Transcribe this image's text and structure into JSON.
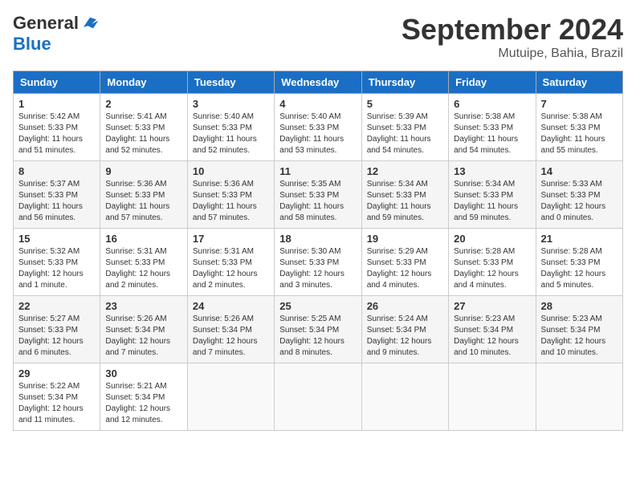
{
  "header": {
    "logo_general": "General",
    "logo_blue": "Blue",
    "title": "September 2024",
    "location": "Mutuipe, Bahia, Brazil"
  },
  "weekdays": [
    "Sunday",
    "Monday",
    "Tuesday",
    "Wednesday",
    "Thursday",
    "Friday",
    "Saturday"
  ],
  "weeks": [
    [
      {
        "day": "1",
        "info": "Sunrise: 5:42 AM\nSunset: 5:33 PM\nDaylight: 11 hours\nand 51 minutes."
      },
      {
        "day": "2",
        "info": "Sunrise: 5:41 AM\nSunset: 5:33 PM\nDaylight: 11 hours\nand 52 minutes."
      },
      {
        "day": "3",
        "info": "Sunrise: 5:40 AM\nSunset: 5:33 PM\nDaylight: 11 hours\nand 52 minutes."
      },
      {
        "day": "4",
        "info": "Sunrise: 5:40 AM\nSunset: 5:33 PM\nDaylight: 11 hours\nand 53 minutes."
      },
      {
        "day": "5",
        "info": "Sunrise: 5:39 AM\nSunset: 5:33 PM\nDaylight: 11 hours\nand 54 minutes."
      },
      {
        "day": "6",
        "info": "Sunrise: 5:38 AM\nSunset: 5:33 PM\nDaylight: 11 hours\nand 54 minutes."
      },
      {
        "day": "7",
        "info": "Sunrise: 5:38 AM\nSunset: 5:33 PM\nDaylight: 11 hours\nand 55 minutes."
      }
    ],
    [
      {
        "day": "8",
        "info": "Sunrise: 5:37 AM\nSunset: 5:33 PM\nDaylight: 11 hours\nand 56 minutes."
      },
      {
        "day": "9",
        "info": "Sunrise: 5:36 AM\nSunset: 5:33 PM\nDaylight: 11 hours\nand 57 minutes."
      },
      {
        "day": "10",
        "info": "Sunrise: 5:36 AM\nSunset: 5:33 PM\nDaylight: 11 hours\nand 57 minutes."
      },
      {
        "day": "11",
        "info": "Sunrise: 5:35 AM\nSunset: 5:33 PM\nDaylight: 11 hours\nand 58 minutes."
      },
      {
        "day": "12",
        "info": "Sunrise: 5:34 AM\nSunset: 5:33 PM\nDaylight: 11 hours\nand 59 minutes."
      },
      {
        "day": "13",
        "info": "Sunrise: 5:34 AM\nSunset: 5:33 PM\nDaylight: 11 hours\nand 59 minutes."
      },
      {
        "day": "14",
        "info": "Sunrise: 5:33 AM\nSunset: 5:33 PM\nDaylight: 12 hours\nand 0 minutes."
      }
    ],
    [
      {
        "day": "15",
        "info": "Sunrise: 5:32 AM\nSunset: 5:33 PM\nDaylight: 12 hours\nand 1 minute."
      },
      {
        "day": "16",
        "info": "Sunrise: 5:31 AM\nSunset: 5:33 PM\nDaylight: 12 hours\nand 2 minutes."
      },
      {
        "day": "17",
        "info": "Sunrise: 5:31 AM\nSunset: 5:33 PM\nDaylight: 12 hours\nand 2 minutes."
      },
      {
        "day": "18",
        "info": "Sunrise: 5:30 AM\nSunset: 5:33 PM\nDaylight: 12 hours\nand 3 minutes."
      },
      {
        "day": "19",
        "info": "Sunrise: 5:29 AM\nSunset: 5:33 PM\nDaylight: 12 hours\nand 4 minutes."
      },
      {
        "day": "20",
        "info": "Sunrise: 5:28 AM\nSunset: 5:33 PM\nDaylight: 12 hours\nand 4 minutes."
      },
      {
        "day": "21",
        "info": "Sunrise: 5:28 AM\nSunset: 5:33 PM\nDaylight: 12 hours\nand 5 minutes."
      }
    ],
    [
      {
        "day": "22",
        "info": "Sunrise: 5:27 AM\nSunset: 5:33 PM\nDaylight: 12 hours\nand 6 minutes."
      },
      {
        "day": "23",
        "info": "Sunrise: 5:26 AM\nSunset: 5:34 PM\nDaylight: 12 hours\nand 7 minutes."
      },
      {
        "day": "24",
        "info": "Sunrise: 5:26 AM\nSunset: 5:34 PM\nDaylight: 12 hours\nand 7 minutes."
      },
      {
        "day": "25",
        "info": "Sunrise: 5:25 AM\nSunset: 5:34 PM\nDaylight: 12 hours\nand 8 minutes."
      },
      {
        "day": "26",
        "info": "Sunrise: 5:24 AM\nSunset: 5:34 PM\nDaylight: 12 hours\nand 9 minutes."
      },
      {
        "day": "27",
        "info": "Sunrise: 5:23 AM\nSunset: 5:34 PM\nDaylight: 12 hours\nand 10 minutes."
      },
      {
        "day": "28",
        "info": "Sunrise: 5:23 AM\nSunset: 5:34 PM\nDaylight: 12 hours\nand 10 minutes."
      }
    ],
    [
      {
        "day": "29",
        "info": "Sunrise: 5:22 AM\nSunset: 5:34 PM\nDaylight: 12 hours\nand 11 minutes."
      },
      {
        "day": "30",
        "info": "Sunrise: 5:21 AM\nSunset: 5:34 PM\nDaylight: 12 hours\nand 12 minutes."
      },
      {
        "day": "",
        "info": ""
      },
      {
        "day": "",
        "info": ""
      },
      {
        "day": "",
        "info": ""
      },
      {
        "day": "",
        "info": ""
      },
      {
        "day": "",
        "info": ""
      }
    ]
  ]
}
